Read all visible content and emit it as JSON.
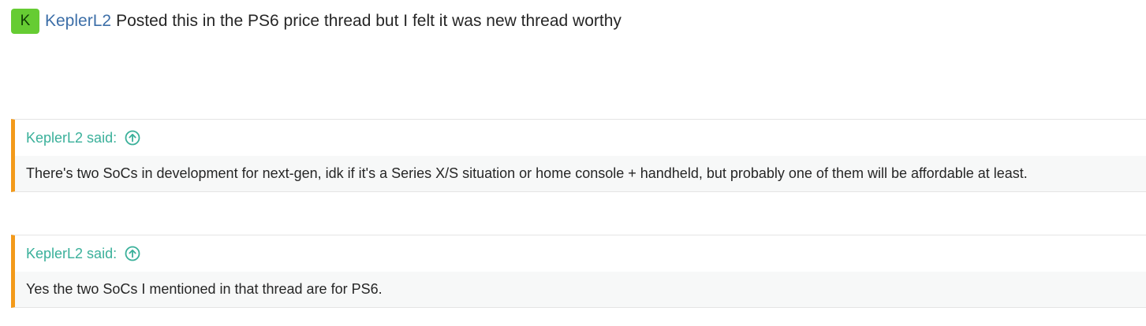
{
  "post": {
    "avatar_letter": "K",
    "username": "KeplerL2",
    "text": "Posted this in the PS6 price thread but I felt it was new thread worthy"
  },
  "quotes": [
    {
      "author": "KeplerL2 said:",
      "body": "There's two SoCs in development for next-gen, idk if it's a Series X/S situation or home console + handheld, but probably one of them will be affordable at least."
    },
    {
      "author": "KeplerL2 said:",
      "body": "Yes the two SoCs I mentioned in that thread are for PS6."
    }
  ],
  "colors": {
    "avatar_bg": "#66cc33",
    "username": "#3d6fa8",
    "quote_accent": "#f39a1a",
    "quote_author": "#3ab09a"
  },
  "icons": {
    "quote_expand": "arrow-up-circle-icon"
  }
}
